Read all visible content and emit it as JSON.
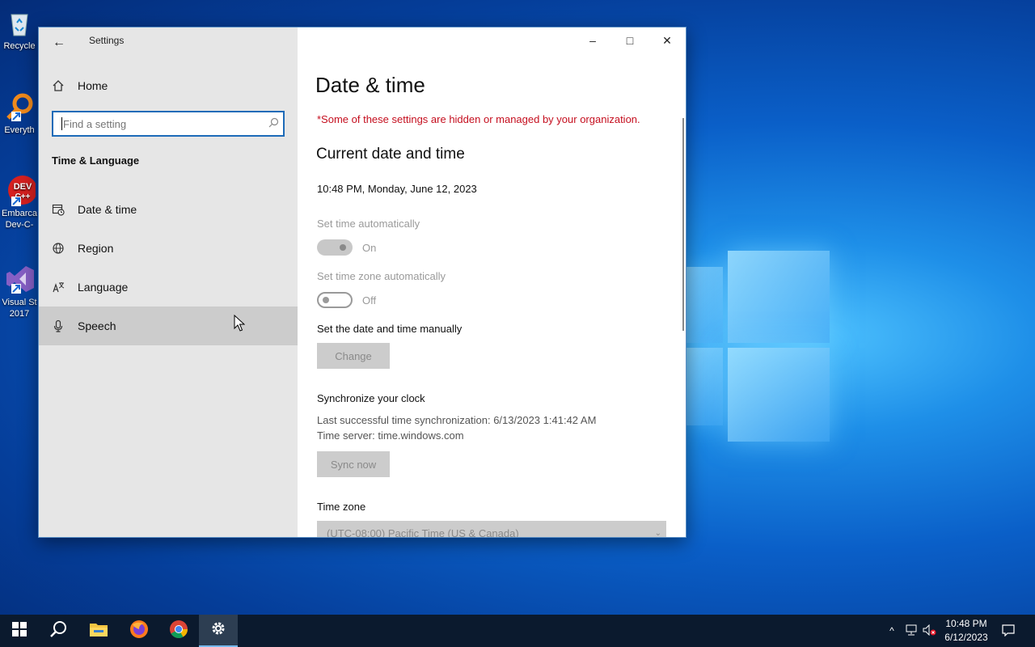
{
  "desktop": {
    "icons": [
      {
        "label": "Recycle",
        "icon": "recycle-bin-icon"
      },
      {
        "label": "Everyth",
        "icon": "everything-search-icon"
      },
      {
        "label": "Embarca",
        "label2": "Dev-C-",
        "icon": "dev-cpp-icon"
      },
      {
        "label": "Visual St",
        "label2": "2017",
        "icon": "visual-studio-icon"
      }
    ]
  },
  "window": {
    "title": "Settings",
    "controls": {
      "minimize": "–",
      "maximize": "□",
      "close": "✕"
    }
  },
  "sidebar": {
    "home_label": "Home",
    "search_placeholder": "Find a setting",
    "section_title": "Time & Language",
    "items": [
      {
        "label": "Date & time",
        "icon": "calendar-clock-icon"
      },
      {
        "label": "Region",
        "icon": "globe-icon"
      },
      {
        "label": "Language",
        "icon": "language-icon"
      },
      {
        "label": "Speech",
        "icon": "microphone-icon"
      }
    ]
  },
  "content": {
    "title": "Date & time",
    "org_notice": "*Some of these settings are hidden or managed by your organization.",
    "current_heading": "Current date and time",
    "current_value": "10:48 PM, Monday, June 12, 2023",
    "set_time_auto_label": "Set time automatically",
    "set_time_auto_state": "On",
    "set_tz_auto_label": "Set time zone automatically",
    "set_tz_auto_state": "Off",
    "manual_label": "Set the date and time manually",
    "change_button": "Change",
    "sync_heading": "Synchronize your clock",
    "sync_last": "Last successful time synchronization: 6/13/2023 1:41:42 AM",
    "sync_server": "Time server: time.windows.com",
    "sync_button": "Sync now",
    "timezone_label": "Time zone",
    "timezone_value": "(UTC-08:00) Pacific Time (US & Canada)"
  },
  "taskbar": {
    "clock_time": "10:48 PM",
    "clock_date": "6/12/2023",
    "apps": [
      "start-icon",
      "search-icon",
      "file-explorer-icon",
      "firefox-icon",
      "chrome-icon",
      "settings-gear-icon"
    ]
  },
  "colors": {
    "accent": "#1e6bb8",
    "warning": "#c50f1f",
    "taskbar": "#0b1a2e"
  }
}
